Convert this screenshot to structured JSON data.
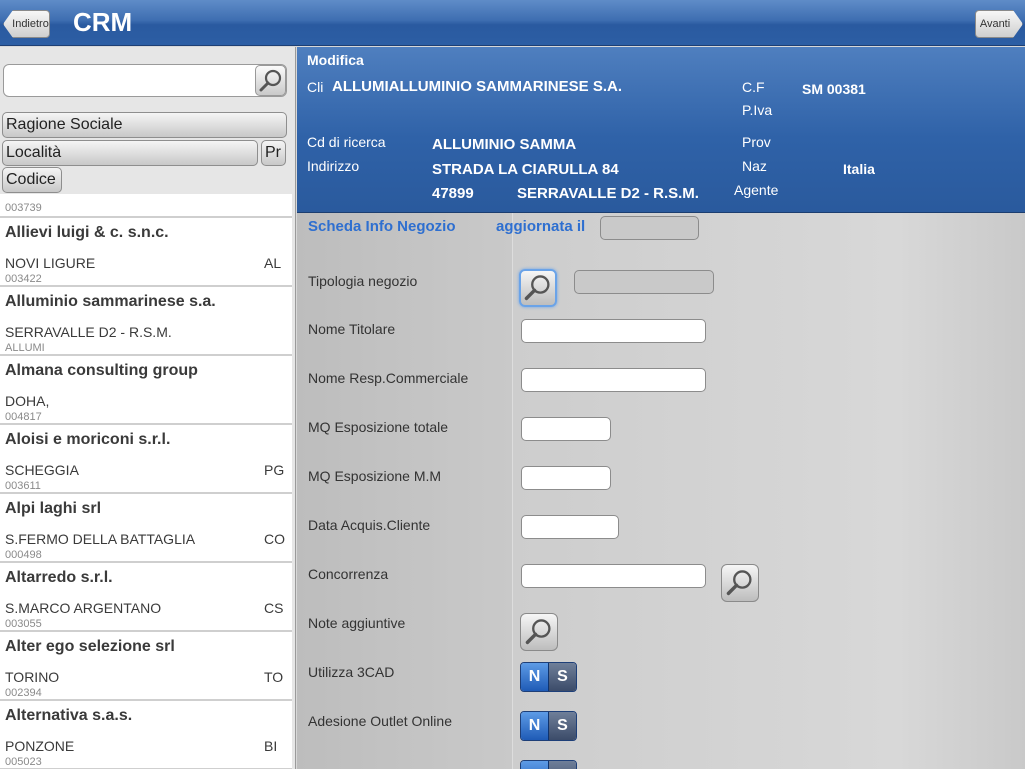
{
  "topbar": {
    "title": "CRM",
    "back_label": "Indietro",
    "forward_label": "Avanti"
  },
  "left": {
    "search": {
      "value": "",
      "placeholder": ""
    },
    "filters": {
      "ragione_sociale": "Ragione Sociale",
      "localita": "Località",
      "provincia": "Pr",
      "codice": "Codice"
    },
    "first_code": "003739",
    "items": [
      {
        "name": "Allievi luigi & c. s.n.c.",
        "city": "NOVI LIGURE",
        "prov": "AL",
        "code": "003422"
      },
      {
        "name": "Alluminio sammarinese s.a.",
        "city": "SERRAVALLE D2 - R.S.M.",
        "prov": "",
        "code": "ALLUMI"
      },
      {
        "name": "Almana consulting group",
        "city": "DOHA,",
        "prov": "",
        "code": "004817"
      },
      {
        "name": "Aloisi e moriconi s.r.l.",
        "city": "SCHEGGIA",
        "prov": "PG",
        "code": "003611"
      },
      {
        "name": "Alpi laghi srl",
        "city": "S.FERMO DELLA BATTAGLIA",
        "prov": "CO",
        "code": "000498"
      },
      {
        "name": "Altarredo s.r.l.",
        "city": "S.MARCO ARGENTANO",
        "prov": "CS",
        "code": "003055"
      },
      {
        "name": "Alter ego selezione srl",
        "city": "TORINO",
        "prov": "TO",
        "code": "002394"
      },
      {
        "name": "Alternativa s.a.s.",
        "city": "PONZONE",
        "prov": "BI",
        "code": "005023"
      }
    ]
  },
  "header": {
    "mode": "Modifica",
    "cli_label": "Cli",
    "cli_value": "ALLUMIALLUMINIO SAMMARINESE S.A.",
    "cf_label": "C.F",
    "piva_label": "P.Iva",
    "piva_value": "SM 00381",
    "cd_ricerca_label": "Cd di ricerca",
    "cd_ricerca_value": "ALLUMINIO SAMMA",
    "indirizzo_label": "Indirizzo",
    "indirizzo_value": "STRADA LA CIARULLA 84",
    "cap": "47899",
    "citta": "SERRAVALLE D2 - R.S.M.",
    "prov_label": "Prov",
    "naz_label": "Naz",
    "naz_value": "Italia",
    "agente_label": "Agente"
  },
  "form": {
    "section_title": "Scheda Info Negozio",
    "updated_label": "aggiornata il",
    "fields": {
      "tipologia": "Tipologia negozio",
      "nome_titolare": "Nome Titolare",
      "nome_resp": "Nome Resp.Commerciale",
      "mq_totale": "MQ Esposizione totale",
      "mq_mm": "MQ Esposizione M.M",
      "data_acquis": "Data Acquis.Cliente",
      "concorrenza": "Concorrenza",
      "note": "Note aggiuntive",
      "utilizza_3cad": "Utilizza 3CAD",
      "adesione_outlet": "Adesione Outlet Online"
    },
    "toggle": {
      "no": "N",
      "yes": "S"
    }
  },
  "icons": {
    "search": "magnifier-icon"
  }
}
